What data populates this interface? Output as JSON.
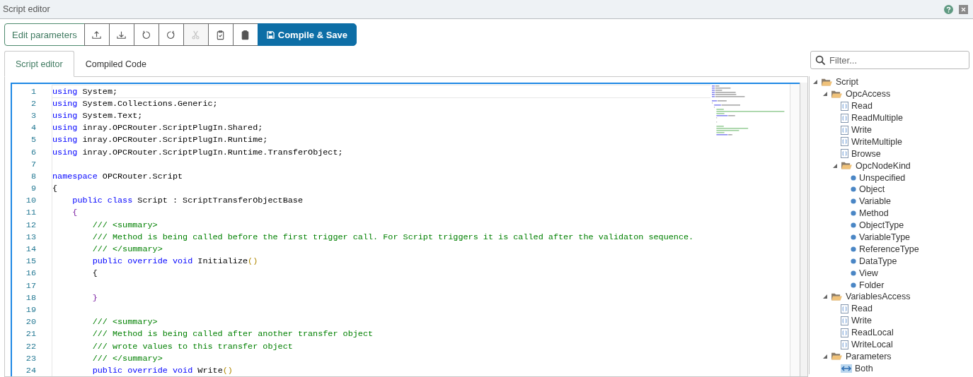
{
  "window": {
    "title": "Script editor"
  },
  "toolbar": [
    {
      "kind": "text",
      "label": "Edit parameters",
      "disabled": false
    },
    {
      "kind": "icon",
      "disabled": false
    },
    {
      "kind": "icon",
      "disabled": false
    },
    {
      "kind": "icon",
      "disabled": false
    },
    {
      "kind": "icon",
      "disabled": false
    },
    {
      "kind": "icon",
      "disabled": true
    },
    {
      "kind": "icon",
      "disabled": false
    },
    {
      "kind": "icon",
      "disabled": false
    },
    {
      "kind": "primary",
      "label": "Compile & Save",
      "disabled": false
    }
  ],
  "tabs": [
    {
      "label": "Script editor",
      "selected": true
    },
    {
      "label": "Compiled Code",
      "selected": false
    }
  ],
  "editor": {
    "lines": [
      {
        "number": "1",
        "current": true,
        "tokens": [
          {
            "kind": "kw",
            "text": "using"
          },
          {
            "kind": "txt",
            "text": " System;"
          }
        ]
      },
      {
        "number": "2",
        "current": false,
        "tokens": [
          {
            "kind": "kw",
            "text": "using"
          },
          {
            "kind": "txt",
            "text": " System.Collections.Generic;"
          }
        ]
      },
      {
        "number": "3",
        "current": false,
        "tokens": [
          {
            "kind": "kw",
            "text": "using"
          },
          {
            "kind": "txt",
            "text": " System.Text;"
          }
        ]
      },
      {
        "number": "4",
        "current": false,
        "tokens": [
          {
            "kind": "kw",
            "text": "using"
          },
          {
            "kind": "txt",
            "text": " inray.OPCRouter.ScriptPlugIn.Shared;"
          }
        ]
      },
      {
        "number": "5",
        "current": false,
        "tokens": [
          {
            "kind": "kw",
            "text": "using"
          },
          {
            "kind": "txt",
            "text": " inray.OPCRouter.ScriptPlugIn.Runtime;"
          }
        ]
      },
      {
        "number": "6",
        "current": false,
        "tokens": [
          {
            "kind": "kw",
            "text": "using"
          },
          {
            "kind": "txt",
            "text": " inray.OPCRouter.ScriptPlugIn.Runtime.TransferObject;"
          }
        ]
      },
      {
        "number": "7",
        "current": false
      },
      {
        "number": "8",
        "current": false,
        "tokens": [
          {
            "kind": "kw",
            "text": "namespace"
          },
          {
            "kind": "txt",
            "text": " OPCRouter.Script"
          }
        ]
      },
      {
        "number": "9",
        "current": false,
        "tokens": [
          {
            "kind": "txt",
            "text": "{"
          }
        ]
      },
      {
        "number": "10",
        "current": false,
        "tokens": [
          {
            "kind": "kw",
            "text": "    public class"
          },
          {
            "kind": "txt",
            "text": " Script : ScriptTransferObjectBase"
          }
        ]
      },
      {
        "number": "11",
        "current": false,
        "tokens": [
          {
            "kind": "brace",
            "text": "    {"
          }
        ]
      },
      {
        "number": "12",
        "current": false,
        "tokens": [
          {
            "kind": "com",
            "text": "        /// <summary>"
          }
        ]
      },
      {
        "number": "13",
        "current": false,
        "tokens": [
          {
            "kind": "com",
            "text": "        /// Method is being called before the first trigger call. For Script triggers it is called after the validaton sequence."
          }
        ]
      },
      {
        "number": "14",
        "current": false,
        "tokens": [
          {
            "kind": "com",
            "text": "        /// </summary>"
          }
        ]
      },
      {
        "number": "15",
        "current": false,
        "tokens": [
          {
            "kind": "kw",
            "text": "        public override void"
          },
          {
            "kind": "txt",
            "text": " Initialize"
          },
          {
            "kind": "paren",
            "text": "()"
          }
        ]
      },
      {
        "number": "16",
        "current": false,
        "tokens": [
          {
            "kind": "txt",
            "text": "        {"
          }
        ]
      },
      {
        "number": "17",
        "current": false
      },
      {
        "number": "18",
        "current": false,
        "tokens": [
          {
            "kind": "brace",
            "text": "        }"
          }
        ]
      },
      {
        "number": "19",
        "current": false
      },
      {
        "number": "20",
        "current": false,
        "tokens": [
          {
            "kind": "com",
            "text": "        /// <summary>"
          }
        ]
      },
      {
        "number": "21",
        "current": false,
        "tokens": [
          {
            "kind": "com",
            "text": "        /// Method is being called after another transfer object"
          }
        ]
      },
      {
        "number": "22",
        "current": false,
        "tokens": [
          {
            "kind": "com",
            "text": "        /// wrote values to this transfer object"
          }
        ]
      },
      {
        "number": "23",
        "current": false,
        "tokens": [
          {
            "kind": "com",
            "text": "        /// </summary>"
          }
        ]
      },
      {
        "number": "24",
        "current": false,
        "tokens": [
          {
            "kind": "kw",
            "text": "        public override void"
          },
          {
            "kind": "txt",
            "text": " Write"
          },
          {
            "kind": "paren",
            "text": "()"
          }
        ]
      }
    ]
  },
  "filter": {
    "placeholder": "Filter..."
  },
  "tree": [
    {
      "kind": "folder",
      "label": "Script",
      "expanded": true,
      "children": [
        {
          "kind": "folder",
          "label": "OpcAccess",
          "expanded": true,
          "children": [
            {
              "kind": "method",
              "label": "Read"
            },
            {
              "kind": "method",
              "label": "ReadMultiple"
            },
            {
              "kind": "method",
              "label": "Write"
            },
            {
              "kind": "method",
              "label": "WriteMultiple"
            },
            {
              "kind": "method",
              "label": "Browse"
            },
            {
              "kind": "folder",
              "label": "OpcNodeKind",
              "expanded": true,
              "children": [
                {
                  "kind": "value",
                  "label": "Unspecified"
                },
                {
                  "kind": "value",
                  "label": "Object"
                },
                {
                  "kind": "value",
                  "label": "Variable"
                },
                {
                  "kind": "value",
                  "label": "Method"
                },
                {
                  "kind": "value",
                  "label": "ObjectType"
                },
                {
                  "kind": "value",
                  "label": "VariableType"
                },
                {
                  "kind": "value",
                  "label": "ReferenceType"
                },
                {
                  "kind": "value",
                  "label": "DataType"
                },
                {
                  "kind": "value",
                  "label": "View"
                },
                {
                  "kind": "value",
                  "label": "Folder"
                }
              ]
            }
          ]
        },
        {
          "kind": "folder",
          "label": "VariablesAccess",
          "expanded": true,
          "children": [
            {
              "kind": "method",
              "label": "Read"
            },
            {
              "kind": "method",
              "label": "Write"
            },
            {
              "kind": "method",
              "label": "ReadLocal"
            },
            {
              "kind": "method",
              "label": "WriteLocal"
            }
          ]
        },
        {
          "kind": "folder",
          "label": "Parameters",
          "expanded": true,
          "children": [
            {
              "kind": "parameter",
              "label": "Both"
            }
          ]
        }
      ]
    }
  ]
}
